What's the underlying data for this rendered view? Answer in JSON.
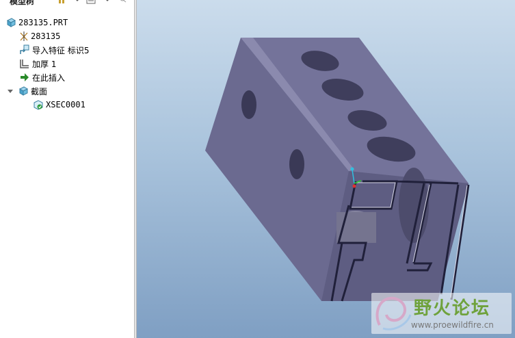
{
  "sidebar": {
    "toolbar_title": "模型树",
    "tree": [
      {
        "label": "283135.PRT",
        "icon": "part-icon"
      },
      {
        "label": "283135",
        "icon": "csys-icon"
      },
      {
        "label": "导入特征 标识5",
        "icon": "import-feature-icon"
      },
      {
        "label": "加厚 1",
        "icon": "thicken-icon"
      },
      {
        "label": "在此插入",
        "icon": "insert-here-arrow-icon"
      },
      {
        "label": "截面",
        "icon": "section-folder-icon"
      },
      {
        "label": "XSEC0001",
        "icon": "xsec-icon"
      }
    ]
  },
  "watermark": {
    "text": "野火论坛",
    "url": "www.proewildfire.cn"
  },
  "colors": {
    "model_face_top": "#77769a",
    "model_face_side": "#6a6a90",
    "model_edge": "#20203a",
    "accent_insert_arrow": "#2a8a2a",
    "watermark_green": "#6fa23c"
  }
}
